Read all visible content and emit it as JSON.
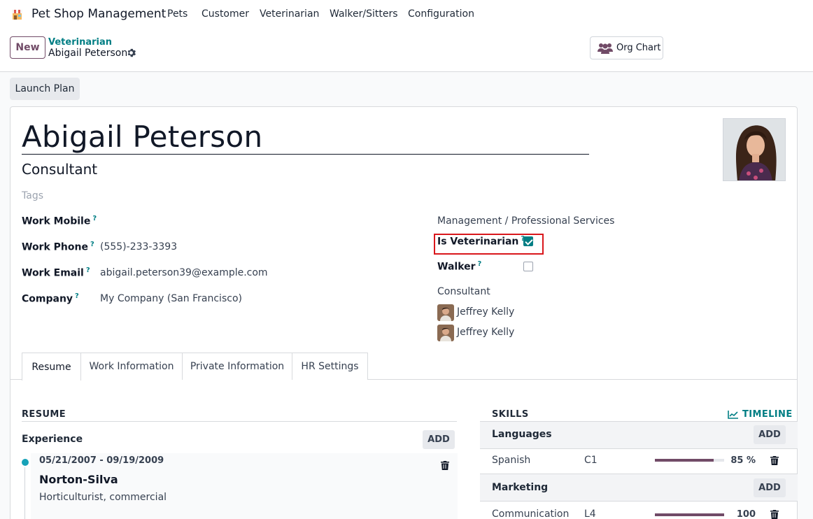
{
  "app": {
    "name": "Pet Shop Management"
  },
  "nav": [
    {
      "label": "Pets"
    },
    {
      "label": "Customer"
    },
    {
      "label": "Veterinarian"
    },
    {
      "label": "Walker/Sitters"
    },
    {
      "label": "Configuration"
    }
  ],
  "control": {
    "new_label": "New",
    "breadcrumb_parent": "Veterinarian",
    "breadcrumb_current": "Abigail Peterson",
    "org_chart_label": "Org Chart",
    "launch_plan_label": "Launch Plan"
  },
  "employee": {
    "name": "Abigail Peterson",
    "job_title": "Consultant",
    "tags_placeholder": "Tags",
    "fields": {
      "work_mobile": {
        "label": "Work Mobile",
        "value": ""
      },
      "work_phone": {
        "label": "Work Phone",
        "value": "(555)-233-3393"
      },
      "work_email": {
        "label": "Work Email",
        "value": "abigail.peterson39@example.com"
      },
      "company": {
        "label": "Company",
        "value": "My Company (San Francisco)"
      }
    },
    "department": "Management / Professional Services",
    "is_veterinarian": {
      "label": "Is Veterinarian",
      "checked": true
    },
    "walker": {
      "label": "Walker",
      "checked": false
    },
    "position": "Consultant",
    "manager": "Jeffrey Kelly",
    "coach": "Jeffrey Kelly",
    "help_mark": "?"
  },
  "tabs": [
    {
      "label": "Resume",
      "active": true
    },
    {
      "label": "Work Information",
      "active": false
    },
    {
      "label": "Private Information",
      "active": false
    },
    {
      "label": "HR Settings",
      "active": false
    }
  ],
  "resume": {
    "title": "RESUME",
    "experience_label": "Experience",
    "add_label": "ADD",
    "entries": [
      {
        "dates": "05/21/2007 - 09/19/2009",
        "company": "Norton-Silva",
        "description": "Horticulturist, commercial"
      }
    ]
  },
  "skills": {
    "title": "SKILLS",
    "timeline_label": "TIMELINE",
    "add_label": "ADD",
    "groups": [
      {
        "name": "Languages",
        "items": [
          {
            "name": "Spanish",
            "level": "C1",
            "progress": 85,
            "pct_label": "85 %"
          }
        ]
      },
      {
        "name": "Marketing",
        "items": [
          {
            "name": "Communication",
            "level": "L4",
            "progress": 100,
            "pct_label": "100 %"
          }
        ]
      }
    ]
  },
  "colors": {
    "brand": "#714B67",
    "teal": "#017e84",
    "highlight": "#d9171c"
  }
}
